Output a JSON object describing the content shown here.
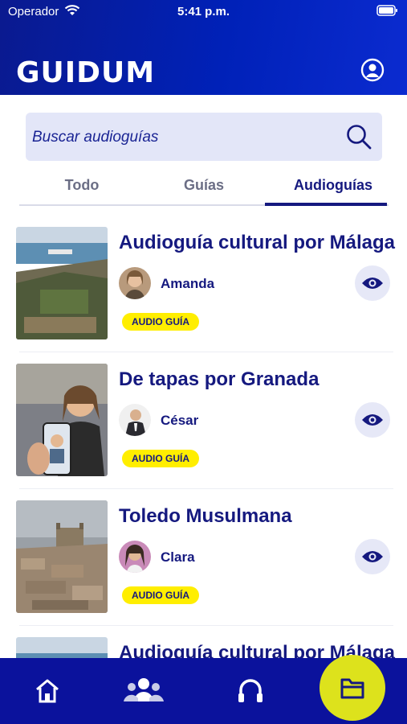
{
  "status_bar": {
    "carrier": "Operador",
    "time": "5:41 p.m."
  },
  "header": {
    "logo": "GUIDUM"
  },
  "search": {
    "placeholder": "Buscar audioguías"
  },
  "tabs": [
    {
      "label": "Todo"
    },
    {
      "label": "Guías"
    },
    {
      "label": "Audioguías",
      "active": true
    }
  ],
  "cards": [
    {
      "title": "Audioguía cultural por Málaga",
      "author": "Amanda",
      "badge": "AUDIO GUÍA"
    },
    {
      "title": "De tapas por Granada",
      "author": "César",
      "badge": "AUDIO GUÍA"
    },
    {
      "title": "Toledo Musulmana",
      "author": "Clara",
      "badge": "AUDIO GUÍA"
    },
    {
      "title": "Audioguía cultural por Málaga"
    }
  ],
  "bottom_nav": [
    "home-icon",
    "community-icon",
    "headphones-icon",
    "folder-icon"
  ],
  "colors": {
    "primary": "#15197f",
    "header": "#0021b8",
    "badge": "#ffee00",
    "fab": "#dde21c"
  }
}
